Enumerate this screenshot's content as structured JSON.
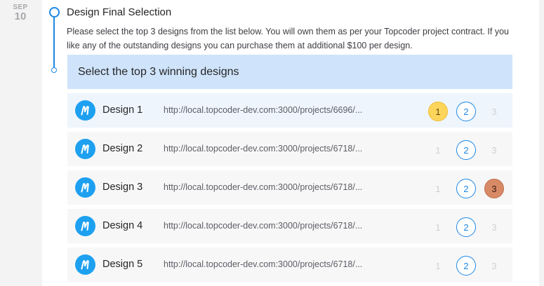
{
  "date": {
    "month": "SEP",
    "day": "10"
  },
  "step": {
    "title": "Design Final Selection",
    "description": "Please select the top 3 designs from the list below. You will own them as per your Topcoder project contract. If you like any of the outstanding designs you can purchase them at additional $100 per design."
  },
  "banner": {
    "text": "Select the top 3 winning designs"
  },
  "colors": {
    "accent": "#1e88e5",
    "banner_bg": "#cfe4fa",
    "gold": "#fcd55a",
    "bronze": "#d88a66",
    "app_icon": "#1ea0f0"
  },
  "designs": [
    {
      "name": "Design 1",
      "url": "http://local.topcoder-dev.com:3000/projects/6696/...",
      "icon": "marvelapp-icon",
      "ranks": [
        "1",
        "2",
        "3"
      ],
      "rank_states": [
        "gold",
        "outline",
        "inactive"
      ]
    },
    {
      "name": "Design 2",
      "url": "http://local.topcoder-dev.com:3000/projects/6718/...",
      "icon": "marvelapp-icon",
      "ranks": [
        "1",
        "2",
        "3"
      ],
      "rank_states": [
        "inactive",
        "outline",
        "inactive"
      ]
    },
    {
      "name": "Design 3",
      "url": "http://local.topcoder-dev.com:3000/projects/6718/...",
      "icon": "marvelapp-icon",
      "ranks": [
        "1",
        "2",
        "3"
      ],
      "rank_states": [
        "inactive",
        "outline",
        "bronze"
      ]
    },
    {
      "name": "Design 4",
      "url": "http://local.topcoder-dev.com:3000/projects/6718/...",
      "icon": "marvelapp-icon",
      "ranks": [
        "1",
        "2",
        "3"
      ],
      "rank_states": [
        "inactive",
        "outline",
        "inactive"
      ]
    },
    {
      "name": "Design 5",
      "url": "http://local.topcoder-dev.com:3000/projects/6718/...",
      "icon": "marvelapp-icon",
      "ranks": [
        "1",
        "2",
        "3"
      ],
      "rank_states": [
        "inactive",
        "outline",
        "inactive"
      ]
    }
  ]
}
